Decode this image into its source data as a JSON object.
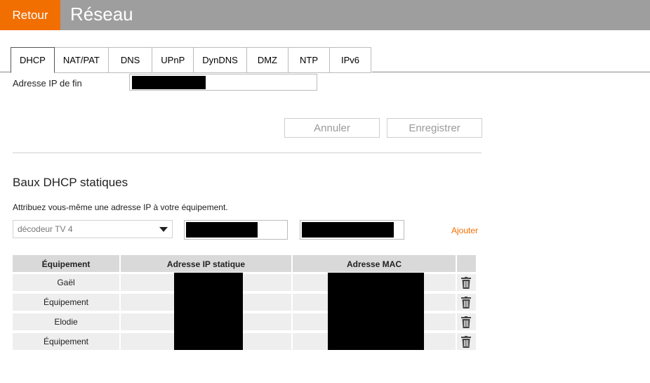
{
  "header": {
    "back_label": "Retour",
    "title": "Réseau"
  },
  "tabs": [
    {
      "label": "DHCP",
      "active": true
    },
    {
      "label": "NAT/PAT"
    },
    {
      "label": "DNS"
    },
    {
      "label": "UPnP"
    },
    {
      "label": "DynDNS"
    },
    {
      "label": "DMZ"
    },
    {
      "label": "NTP"
    },
    {
      "label": "IPv6"
    }
  ],
  "dhcp": {
    "end_ip_label": "Adresse IP de fin"
  },
  "actions": {
    "cancel_label": "Annuler",
    "save_label": "Enregistrer"
  },
  "static_leases": {
    "title": "Baux DHCP statiques",
    "description": "Attribuez vous-même une adresse IP à votre équipement.",
    "device_select_value": "décodeur TV 4",
    "add_label": "Ajouter",
    "columns": [
      "Équipement",
      "Adresse IP statique",
      "Adresse MAC"
    ],
    "rows": [
      {
        "device": "Gaël"
      },
      {
        "device": "Équipement"
      },
      {
        "device": "Elodie"
      },
      {
        "device": "Équipement"
      }
    ]
  },
  "colors": {
    "accent": "#f16e00",
    "topbar": "#9e9e9e"
  }
}
